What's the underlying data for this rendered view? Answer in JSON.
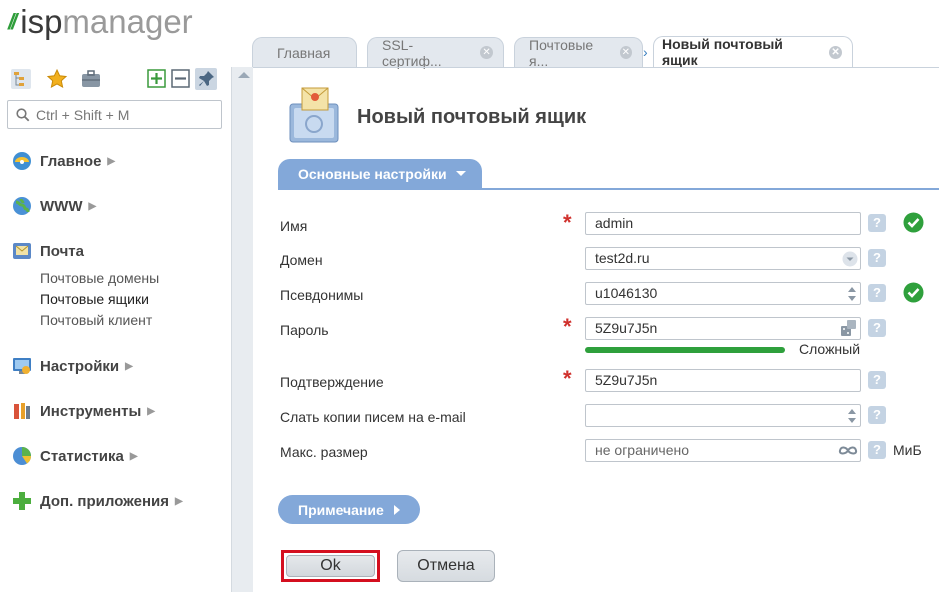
{
  "logo": {
    "prefix": "isp",
    "suffix": "manager"
  },
  "tabs": [
    {
      "label": "Главная"
    },
    {
      "label": "SSL-сертиф..."
    },
    {
      "label": "Почтовые я..."
    },
    {
      "label": "Новый почтовый ящик"
    }
  ],
  "search": {
    "placeholder": "Ctrl + Shift + M"
  },
  "nav": {
    "main": "Главное",
    "www": "WWW",
    "mail": "Почта",
    "mail_sub": [
      "Почтовые домены",
      "Почтовые ящики",
      "Почтовый клиент"
    ],
    "settings": "Настройки",
    "tools": "Инструменты",
    "stats": "Статистика",
    "apps": "Доп. приложения"
  },
  "page": {
    "title": "Новый почтовый ящик",
    "section": "Основные настройки",
    "note": "Примечание"
  },
  "form": {
    "name_label": "Имя",
    "name_value": "admin",
    "domain_label": "Домен",
    "domain_value": "test2d.ru",
    "aliases_label": "Псевдонимы",
    "aliases_value": "u1046130",
    "password_label": "Пароль",
    "password_value": "5Z9u7J5n",
    "strength": "Сложный",
    "strength_level": 1.0,
    "confirm_label": "Подтверждение",
    "confirm_value": "5Z9u7J5n",
    "copies_label": "Слать копии писем на e-mail",
    "copies_value": "",
    "maxsize_label": "Макс. размер",
    "maxsize_placeholder": "не ограничено",
    "maxsize_unit": "МиБ",
    "help": "?",
    "required_mark": "*"
  },
  "buttons": {
    "ok": "Ok",
    "cancel": "Отмена"
  },
  "colors": {
    "accent": "#83a8d9",
    "ok_green": "#2fa03c",
    "required": "#d0312d",
    "ok_border": "#d40f1f"
  }
}
